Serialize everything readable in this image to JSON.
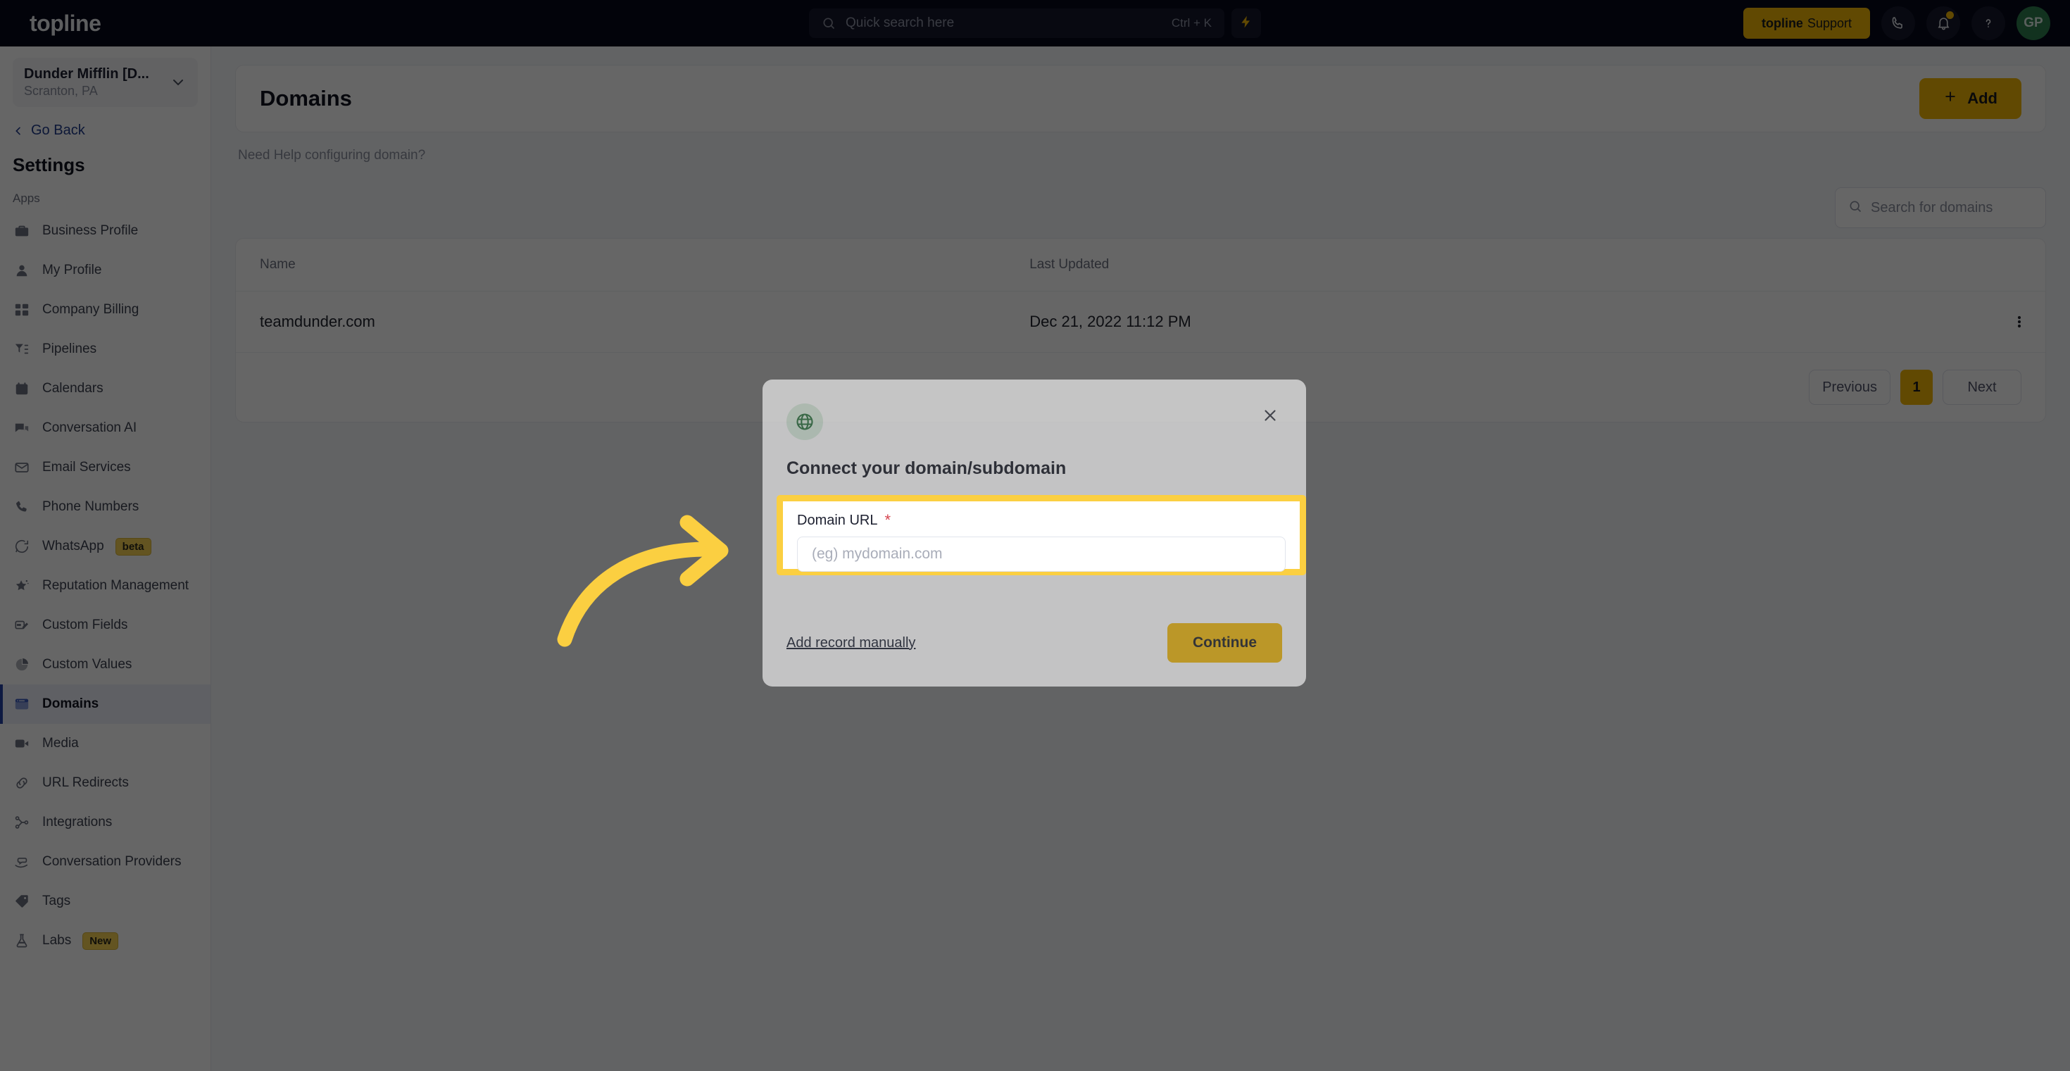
{
  "navbar": {
    "brand": "topline",
    "search": {
      "placeholder": "Quick search here",
      "shortcut": "Ctrl + K",
      "icon": "search-icon"
    },
    "bolt_icon": "lightning-bolt-icon",
    "support_button": {
      "brand": "topline",
      "label": "Support"
    },
    "phone_icon": "phone-icon",
    "bell_icon": "bell-icon",
    "help_icon": "question-mark-icon",
    "avatar_initials": "GP"
  },
  "sidebar": {
    "org": {
      "name": "Dunder Mifflin [D...",
      "location": "Scranton, PA",
      "caret_icon": "chevron-down-icon"
    },
    "go_back": {
      "label": "Go Back",
      "icon": "chevron-left-icon"
    },
    "title": "Settings",
    "group_label": "Apps",
    "items": [
      {
        "label": "Business Profile",
        "icon": "briefcase-icon",
        "badge": ""
      },
      {
        "label": "My Profile",
        "icon": "person-icon",
        "badge": ""
      },
      {
        "label": "Company Billing",
        "icon": "billing-grid-icon",
        "badge": ""
      },
      {
        "label": "Pipelines",
        "icon": "funnel-icon",
        "badge": ""
      },
      {
        "label": "Calendars",
        "icon": "calendar-icon",
        "badge": ""
      },
      {
        "label": "Conversation AI",
        "icon": "chat-bubbles-icon",
        "badge": ""
      },
      {
        "label": "Email Services",
        "icon": "envelope-icon",
        "badge": ""
      },
      {
        "label": "Phone Numbers",
        "icon": "phone-icon",
        "badge": ""
      },
      {
        "label": "WhatsApp",
        "icon": "whatsapp-icon",
        "badge": "beta"
      },
      {
        "label": "Reputation Management",
        "icon": "star-icon",
        "badge": ""
      },
      {
        "label": "Custom Fields",
        "icon": "pencil-field-icon",
        "badge": ""
      },
      {
        "label": "Custom Values",
        "icon": "pie-chart-icon",
        "badge": ""
      },
      {
        "label": "Domains",
        "icon": "browser-window-icon",
        "badge": ""
      },
      {
        "label": "Media",
        "icon": "video-camera-icon",
        "badge": ""
      },
      {
        "label": "URL Redirects",
        "icon": "link-icon",
        "badge": ""
      },
      {
        "label": "Integrations",
        "icon": "nodes-icon",
        "badge": ""
      },
      {
        "label": "Conversation Providers",
        "icon": "hand-chat-icon",
        "badge": ""
      },
      {
        "label": "Tags",
        "icon": "tag-icon",
        "badge": ""
      },
      {
        "label": "Labs",
        "icon": "flask-icon",
        "badge": "New"
      }
    ],
    "active_index": 12
  },
  "main": {
    "page_title": "Domains",
    "add_button": "Add",
    "add_icon": "plus-icon",
    "need_help": "Need Help configuring domain?",
    "search": {
      "placeholder": "Search for domains",
      "icon": "search-icon"
    },
    "table": {
      "columns": [
        "Name",
        "Last Updated"
      ],
      "rows": [
        {
          "name": "teamdunder.com",
          "last_updated": "Dec 21, 2022 11:12 PM",
          "menu_icon": "kebab-menu-icon"
        }
      ]
    },
    "pagination": {
      "previous": "Previous",
      "current_page": "1",
      "next": "Next"
    }
  },
  "modal": {
    "badge_icon": "globe-icon",
    "close_icon": "close-x-icon",
    "title": "Connect your domain/subdomain",
    "field": {
      "label": "Domain URL",
      "required_mark": "*",
      "placeholder": "(eg) mydomain.com",
      "value": ""
    },
    "manual_link": "Add record manually",
    "continue_button": "Continue"
  },
  "annotation": {
    "arrow_icon": "curved-arrow-right-icon",
    "color": "#fbcf41"
  },
  "colors": {
    "navbar_bg": "#07091b",
    "accent_yellow": "#f2b705",
    "highlight_yellow": "#fbcf41",
    "active_nav_blue": "#2342a6",
    "avatar_green": "#2e7d4f",
    "required_red": "#d64550"
  }
}
